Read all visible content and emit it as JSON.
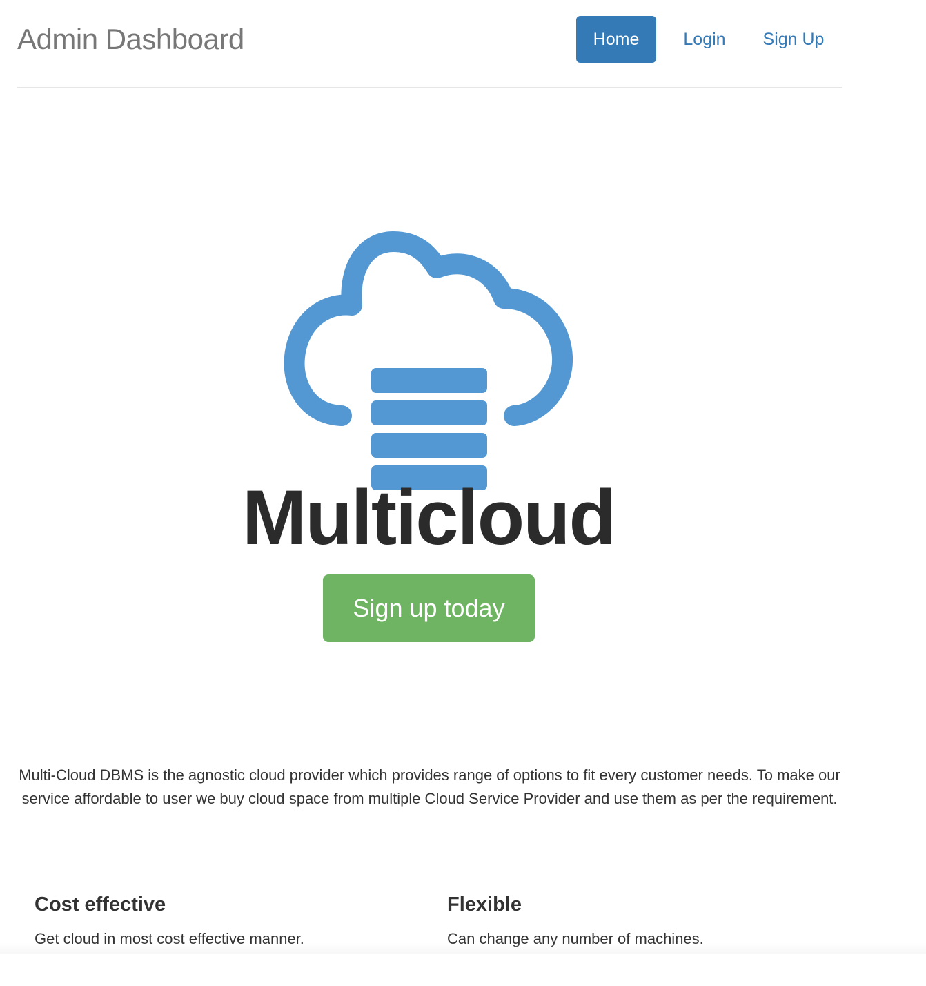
{
  "header": {
    "brand": "Admin Dashboard",
    "nav": [
      {
        "label": "Home",
        "active": true
      },
      {
        "label": "Login",
        "active": false
      },
      {
        "label": "Sign Up",
        "active": false
      }
    ]
  },
  "hero": {
    "logo_icon": "cloud-database-icon",
    "logo_text": "Multicloud",
    "cta_label": "Sign up today"
  },
  "intro": {
    "text": "Multi-Cloud DBMS is the agnostic cloud provider which provides range of options to fit every customer needs. To make our service affordable to user we buy cloud space from multiple Cloud Service Provider and use them as per the requirement."
  },
  "features": [
    {
      "title": "Cost effective",
      "description": "Get cloud in most cost effective manner."
    },
    {
      "title": "Flexible",
      "description": "Can change any number of machines."
    }
  ],
  "colors": {
    "primary": "#337ab7",
    "success": "#6fb463",
    "logo_blue": "#5398d3",
    "brand_gray": "#777777",
    "logo_text": "#2b2b2b"
  }
}
